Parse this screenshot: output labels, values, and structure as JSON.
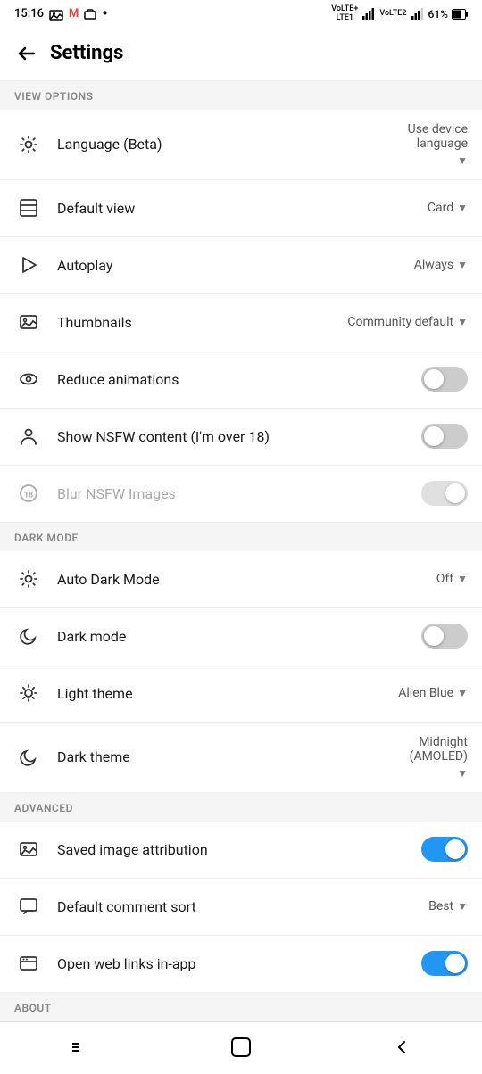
{
  "statusBar": {
    "time": "15:16",
    "batteryPercent": "61%",
    "signalLeft": "VoLTE+\nLTE1",
    "signalRight": "VoLTE2"
  },
  "header": {
    "title": "Settings",
    "backLabel": "back"
  },
  "sections": [
    {
      "id": "view-options",
      "label": "VIEW OPTIONS",
      "items": [
        {
          "id": "language",
          "icon": "gear-icon",
          "label": "Language (Beta)",
          "value": "Use device\nlanguage",
          "type": "dropdown",
          "multiline": true,
          "disabled": false
        },
        {
          "id": "default-view",
          "icon": "layout-icon",
          "label": "Default view",
          "value": "Card",
          "type": "dropdown",
          "multiline": false,
          "disabled": false
        },
        {
          "id": "autoplay",
          "icon": "play-icon",
          "label": "Autoplay",
          "value": "Always",
          "type": "dropdown",
          "multiline": false,
          "disabled": false
        },
        {
          "id": "thumbnails",
          "icon": "image-icon",
          "label": "Thumbnails",
          "value": "Community default",
          "type": "dropdown",
          "multiline": false,
          "disabled": false
        },
        {
          "id": "reduce-animations",
          "icon": "eye-icon",
          "label": "Reduce animations",
          "value": "",
          "type": "toggle",
          "toggleState": "off",
          "disabled": false
        },
        {
          "id": "nsfw-content",
          "icon": "person-icon",
          "label": "Show NSFW content (I'm over 18)",
          "value": "",
          "type": "toggle",
          "toggleState": "off",
          "disabled": false
        },
        {
          "id": "blur-nsfw",
          "icon": "18-icon",
          "label": "Blur NSFW Images",
          "value": "",
          "type": "toggle",
          "toggleState": "disabled",
          "disabled": true
        }
      ]
    },
    {
      "id": "dark-mode",
      "label": "DARK MODE",
      "items": [
        {
          "id": "auto-dark-mode",
          "icon": "gear-icon",
          "label": "Auto Dark Mode",
          "value": "Off",
          "type": "dropdown",
          "multiline": false,
          "disabled": false
        },
        {
          "id": "dark-mode-toggle",
          "icon": "moon-icon",
          "label": "Dark mode",
          "value": "",
          "type": "toggle",
          "toggleState": "off",
          "disabled": false
        },
        {
          "id": "light-theme",
          "icon": "sun-icon",
          "label": "Light theme",
          "value": "Alien Blue",
          "type": "dropdown",
          "multiline": false,
          "disabled": false
        },
        {
          "id": "dark-theme",
          "icon": "moon-icon",
          "label": "Dark theme",
          "value": "Midnight\n(AMOLED)",
          "type": "dropdown",
          "multiline": true,
          "disabled": false
        }
      ]
    },
    {
      "id": "advanced",
      "label": "ADVANCED",
      "items": [
        {
          "id": "saved-image-attribution",
          "icon": "image-icon",
          "label": "Saved image attribution",
          "value": "",
          "type": "toggle",
          "toggleState": "on",
          "disabled": false
        },
        {
          "id": "default-comment-sort",
          "icon": "comment-icon",
          "label": "Default comment sort",
          "value": "Best",
          "type": "dropdown",
          "multiline": false,
          "disabled": false
        },
        {
          "id": "open-web-links",
          "icon": "browser-icon",
          "label": "Open web links in-app",
          "value": "",
          "type": "toggle",
          "toggleState": "on",
          "disabled": false
        }
      ]
    }
  ],
  "bottomSection": {
    "label": "ABOUT"
  },
  "navBar": {
    "items": [
      "menu-icon",
      "home-icon",
      "back-icon"
    ]
  }
}
